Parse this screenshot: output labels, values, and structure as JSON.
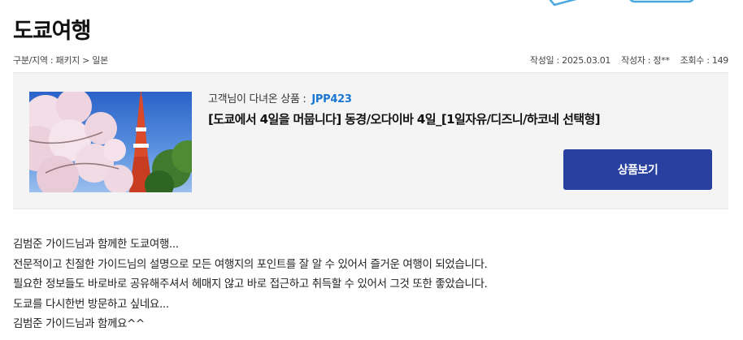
{
  "page": {
    "title": "도쿄여행"
  },
  "meta": {
    "category_label": "구분/지역 : ",
    "category_value": "패키지 > 일본",
    "date_label": "작성일 : ",
    "date_value": "2025.03.01",
    "author_label": "작성자 : ",
    "author_value": "정**",
    "views_label": "조회수 : ",
    "views_value": "149"
  },
  "product": {
    "code_label": "고객님이 다녀온 상품 : ",
    "code": "JPP423",
    "name": "[도쿄에서 4일을 머뭅니다] 동경/오다이바 4일_[1일자유/디즈니/하코네 선택형]",
    "view_button": "상품보기",
    "thumbnail_icon": "tokyo-tower-cherry-blossom-photo"
  },
  "review": {
    "lines": [
      "김범준 가이드님과 함께한 도쿄여행...",
      "전문적이고 친절한 가이드님의 설명으로 모든 여행지의 포인트를 잘 알 수 있어서 즐거운 여행이 되었습니다.",
      "필요한 정보들도 바로바로 공유해주셔서 헤매지 않고 바로 접근하고 취득할 수 있어서 그것 또한 좋았습니다.",
      "도쿄를 다시한번 방문하고 싶네요...",
      "김범준 가이드님과 함께요^^"
    ]
  },
  "colors": {
    "accent_blue": "#1a76d2",
    "button_bg": "#2840a0",
    "card_bg": "#f4f4f4"
  }
}
